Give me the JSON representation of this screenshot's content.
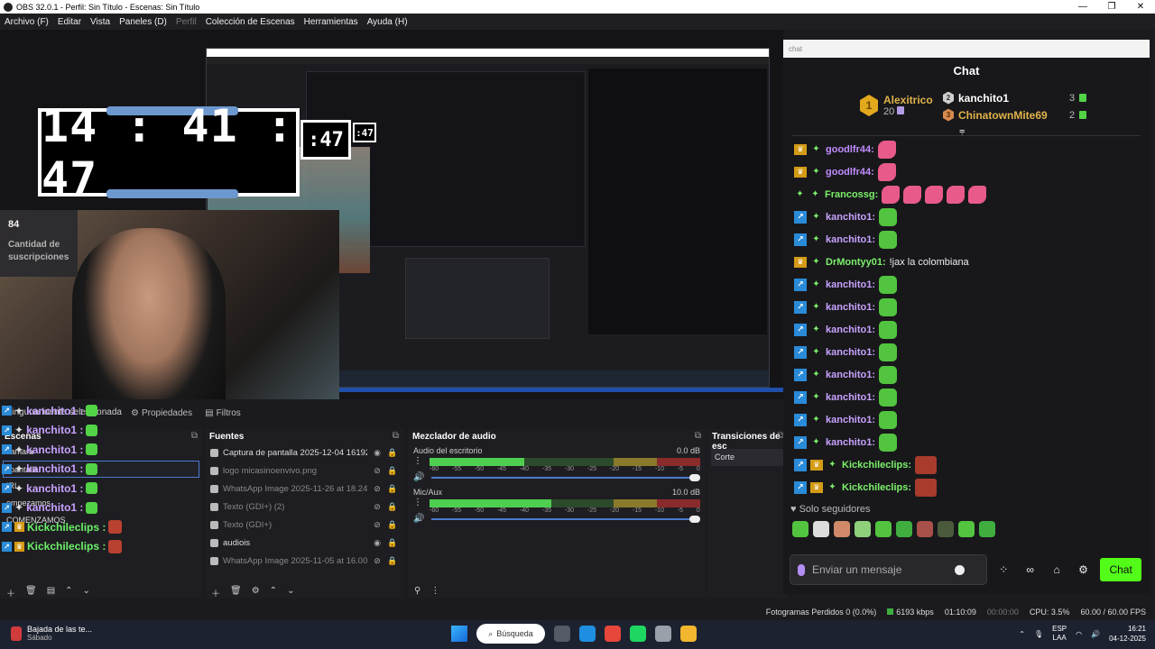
{
  "window": {
    "title": "OBS 32.0.1 - Perfil: Sin Título - Escenas: Sin Título",
    "controls": [
      "—",
      "❐",
      "✕"
    ]
  },
  "menu": [
    "Archivo (F)",
    "Editar",
    "Vista",
    "Paneles (D)",
    "Perfil",
    "Colección de Escenas",
    "Herramientas",
    "Ayuda (H)"
  ],
  "preview": {
    "clock_time": "14 : 41 : 47",
    "clock_small": ":47",
    "clock_tiny": ":47",
    "sub_count": "84",
    "sub_label": "Cantidad de suscripciones",
    "overlay_chat": [
      {
        "user": "kanchito1 :",
        "kind": "g",
        "color": "#c8a2ff"
      },
      {
        "user": "kanchito1 :",
        "kind": "g",
        "color": "#c8a2ff"
      },
      {
        "user": "kanchito1 :",
        "kind": "g",
        "color": "#c8a2ff"
      },
      {
        "user": "kanchito1 :",
        "kind": "g",
        "color": "#c8a2ff"
      },
      {
        "user": "kanchito1 :",
        "kind": "g",
        "color": "#c8a2ff"
      },
      {
        "user": "kanchito1 :",
        "kind": "g",
        "color": "#c8a2ff"
      },
      {
        "user": "Kickchileclips :",
        "kind": "r",
        "color": "#6cf068"
      },
      {
        "user": "Kickchileclips :",
        "kind": "r",
        "color": "#6cf068"
      }
    ]
  },
  "dock_tabs": {
    "no_source": "Ninguna fuente seleccionada",
    "properties": "Propiedades",
    "filters": "Filtros"
  },
  "scenes": {
    "title": "Escenas",
    "items": [
      "camara",
      "pantalla",
      "IRL",
      "empezamos",
      "COMENZAMOS"
    ],
    "selected": "pantalla"
  },
  "sources": {
    "title": "Fuentes",
    "items": [
      {
        "name": "Captura de pantalla 2025-12-04 161927",
        "visible": true
      },
      {
        "name": "logo micasinoenvivo.png",
        "visible": false
      },
      {
        "name": "WhatsApp Image 2025-11-26 at 18.24.5",
        "visible": false
      },
      {
        "name": "Texto (GDI+) (2)",
        "visible": false
      },
      {
        "name": "Texto (GDI+)",
        "visible": false
      },
      {
        "name": "audiois",
        "visible": true
      },
      {
        "name": "WhatsApp Image 2025-11-05 at 16.00.3",
        "visible": false
      }
    ]
  },
  "mixer": {
    "title": "Mezclador de audio",
    "scale": [
      "-60",
      "-55",
      "-50",
      "-45",
      "-40",
      "-35",
      "-30",
      "-25",
      "-20",
      "-15",
      "-10",
      "-5",
      "0"
    ],
    "tracks": [
      {
        "name": "Audio del escritorio",
        "db": "0.0 dB",
        "level": 0.35
      },
      {
        "name": "Mic/Aux",
        "db": "10.0 dB",
        "level": 0.45
      }
    ]
  },
  "transitions": {
    "title": "Transiciones de esc",
    "value": "Corte"
  },
  "chat": {
    "address": "chat",
    "title": "Chat",
    "top": [
      {
        "rank": "1",
        "name": "Alexitrico",
        "points": "20"
      },
      {
        "rank": "2",
        "name": "kanchito1",
        "points": "3"
      },
      {
        "rank": "3",
        "name": "ChinatownMite69",
        "points": "2"
      }
    ],
    "messages": [
      {
        "badges": [
          "crown",
          "char"
        ],
        "user": "goodlfr44:",
        "color": "#c08cff",
        "text": "",
        "emotes": [
          "pink"
        ]
      },
      {
        "badges": [
          "crown",
          "char"
        ],
        "user": "goodlfr44:",
        "color": "#c08cff",
        "text": "",
        "emotes": [
          "pink"
        ]
      },
      {
        "badges": [
          "char",
          "char"
        ],
        "user": "Francossg:",
        "color": "#7cf06a",
        "text": "",
        "emotes": [
          "pink",
          "pink",
          "pink",
          "pink",
          "pink"
        ]
      },
      {
        "badges": [
          "arrow",
          "char"
        ],
        "user": "kanchito1:",
        "color": "#c8a2ff",
        "text": "",
        "emotes": [
          "green"
        ]
      },
      {
        "badges": [
          "arrow",
          "char"
        ],
        "user": "kanchito1:",
        "color": "#c8a2ff",
        "text": "",
        "emotes": [
          "green"
        ]
      },
      {
        "badges": [
          "crown",
          "char"
        ],
        "user": "DrMontyy01:",
        "color": "#7cf06a",
        "text": "!jax la colombiana",
        "emotes": []
      },
      {
        "badges": [
          "arrow",
          "char"
        ],
        "user": "kanchito1:",
        "color": "#c8a2ff",
        "text": "",
        "emotes": [
          "green"
        ]
      },
      {
        "badges": [
          "arrow",
          "char"
        ],
        "user": "kanchito1:",
        "color": "#c8a2ff",
        "text": "",
        "emotes": [
          "green"
        ]
      },
      {
        "badges": [
          "arrow",
          "char"
        ],
        "user": "kanchito1:",
        "color": "#c8a2ff",
        "text": "",
        "emotes": [
          "green"
        ]
      },
      {
        "badges": [
          "arrow",
          "char"
        ],
        "user": "kanchito1:",
        "color": "#c8a2ff",
        "text": "",
        "emotes": [
          "green"
        ]
      },
      {
        "badges": [
          "arrow",
          "char"
        ],
        "user": "kanchito1:",
        "color": "#c8a2ff",
        "text": "",
        "emotes": [
          "green"
        ]
      },
      {
        "badges": [
          "arrow",
          "char"
        ],
        "user": "kanchito1:",
        "color": "#c8a2ff",
        "text": "",
        "emotes": [
          "green"
        ]
      },
      {
        "badges": [
          "arrow",
          "char"
        ],
        "user": "kanchito1:",
        "color": "#c8a2ff",
        "text": "",
        "emotes": [
          "green"
        ]
      },
      {
        "badges": [
          "arrow",
          "char"
        ],
        "user": "kanchito1:",
        "color": "#c8a2ff",
        "text": "",
        "emotes": [
          "green"
        ]
      },
      {
        "badges": [
          "arrow",
          "crown",
          "char"
        ],
        "user": "Kickchileclips:",
        "color": "#7cf06a",
        "text": "",
        "emotes": [
          "face"
        ]
      },
      {
        "badges": [
          "arrow",
          "crown",
          "char"
        ],
        "user": "Kickchileclips:",
        "color": "#7cf06a",
        "text": "",
        "emotes": [
          "face"
        ]
      }
    ],
    "followers_only": "Solo seguidores",
    "emote_colors": [
      "#52c43f",
      "#dddddd",
      "#d08a6a",
      "#8fd17a",
      "#52c43f",
      "#3fae3f",
      "#a8504a",
      "#4a5a3a",
      "#52c43f",
      "#3fae3f"
    ],
    "input_placeholder": "Enviar un mensaje",
    "send_label": "Chat"
  },
  "status": {
    "dropped": "Fotogramas Perdidos 0 (0.0%)",
    "bitrate": "6193 kbps",
    "stream_time": "01:10:09",
    "rec_time": "00:00:00",
    "cpu": "CPU: 3.5%",
    "fps": "60.00 / 60.00 FPS"
  },
  "taskbar": {
    "weather_title": "Bajada de las te...",
    "weather_day": "Sábado",
    "search_label": "Búsqueda",
    "app_colors": [
      "#555b66",
      "#1e8fe0",
      "#e7463a",
      "#1ed760",
      "#9aa0aa",
      "#f2b72e"
    ],
    "lang": "ESP",
    "lang_sub": "LAA",
    "time": "16:21",
    "date": "04-12-2025"
  },
  "colors": {
    "accent_green": "#53fc18",
    "obs_blue": "#4a7bd0"
  }
}
